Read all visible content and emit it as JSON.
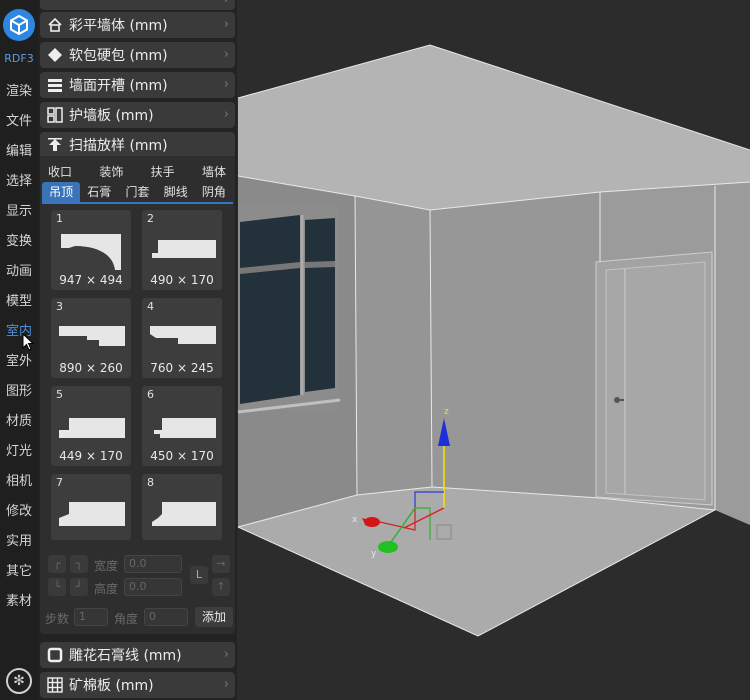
{
  "app": {
    "logo_text": "RDF3"
  },
  "rail": {
    "items": [
      "渲染",
      "文件",
      "编辑",
      "选择",
      "显示",
      "变换",
      "动画",
      "模型",
      "室内",
      "室外",
      "图形",
      "材质",
      "灯光",
      "相机",
      "修改",
      "实用",
      "其它",
      "素材"
    ],
    "active": "室内"
  },
  "sections": {
    "top_partial": "",
    "s1": "彩平墙体 (mm)",
    "s2": "软包硬包 (mm)",
    "s3": "墙面开槽 (mm)",
    "s4": "护墙板 (mm)",
    "s5": "扫描放样 (mm)",
    "s6": "雕花石膏线 (mm)",
    "s7": "矿棉板 (mm)"
  },
  "tabs_row1": [
    "收口",
    "装饰",
    "扶手",
    "墙体"
  ],
  "tabs_row2": [
    "吊顶",
    "石膏",
    "门套",
    "脚线",
    "阴角"
  ],
  "tabs_row2_selected": "吊顶",
  "tiles": [
    {
      "num": "1",
      "dim": "947 × 494"
    },
    {
      "num": "2",
      "dim": "490 × 170"
    },
    {
      "num": "3",
      "dim": "890 × 260"
    },
    {
      "num": "4",
      "dim": "760 × 245"
    },
    {
      "num": "5",
      "dim": "449 × 170"
    },
    {
      "num": "6",
      "dim": "450 × 170"
    },
    {
      "num": "7",
      "dim": ""
    },
    {
      "num": "8",
      "dim": ""
    }
  ],
  "controls": {
    "width_label": "宽度",
    "height_label": "高度",
    "width_value": "0.0",
    "height_value": "0.0",
    "steps_label": "步数",
    "steps_value": "1",
    "angle_label": "角度",
    "angle_value": "0",
    "add_label": "添加",
    "lock_label": "L"
  },
  "viewport": {
    "gizmo_z": "z",
    "gizmo_x": "x",
    "gizmo_y": "y"
  },
  "colors": {
    "accent": "#3b73b8",
    "active_text": "#4c8fd9",
    "logo": "#2f86e0"
  }
}
